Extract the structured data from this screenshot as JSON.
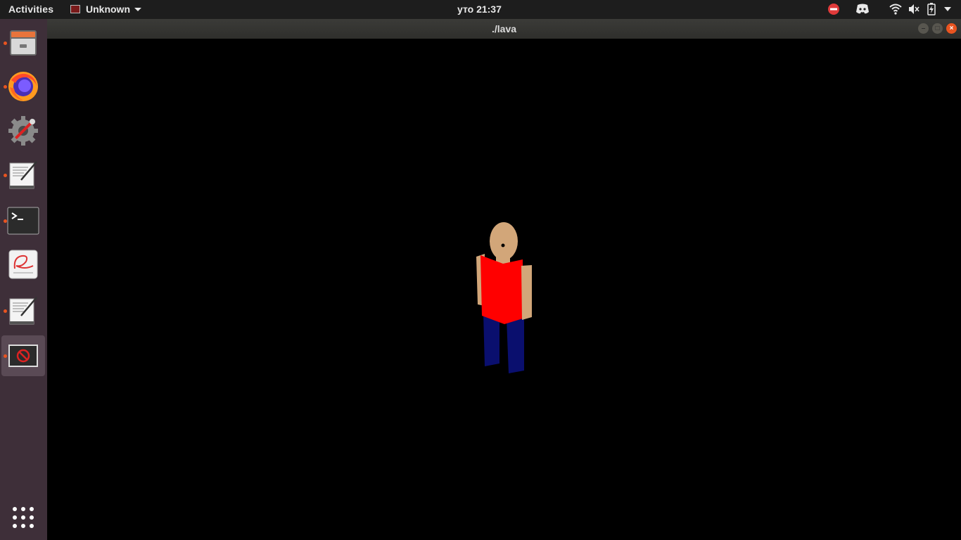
{
  "topbar": {
    "activities_label": "Activities",
    "app_name": "Unknown",
    "clock": "уто 21:37"
  },
  "tray": {
    "icons": [
      "do-not-disturb-icon",
      "discord-icon",
      "wifi-icon",
      "volume-muted-icon",
      "battery-charging-icon",
      "system-menu-arrow-icon"
    ]
  },
  "dock": {
    "items": [
      {
        "name": "files",
        "icon": "file-cabinet-icon",
        "running": true
      },
      {
        "name": "firefox",
        "icon": "firefox-icon",
        "running": true
      },
      {
        "name": "settings",
        "icon": "settings-tools-icon",
        "running": false
      },
      {
        "name": "text-editor",
        "icon": "text-editor-icon",
        "running": true
      },
      {
        "name": "terminal",
        "icon": "terminal-icon",
        "running": true
      },
      {
        "name": "document-viewer",
        "icon": "document-viewer-icon",
        "running": false
      },
      {
        "name": "text-editor-2",
        "icon": "text-editor-icon",
        "running": true
      },
      {
        "name": "lava-app",
        "icon": "unknown-app-icon",
        "running": true,
        "active": true
      }
    ],
    "show_apps_icon": "grid-icon"
  },
  "window": {
    "title": "./lava",
    "controls": [
      "minimize",
      "maximize",
      "close"
    ]
  },
  "scene": {
    "background": "#000000",
    "character": {
      "skin_color": "#d2a679",
      "shirt_color": "#ff0000",
      "pants_color": "#0a0f6e"
    }
  },
  "colors": {
    "topbar_bg": "#1d1d1d",
    "dock_bg": "#3e2f39",
    "accent": "#e95420"
  }
}
